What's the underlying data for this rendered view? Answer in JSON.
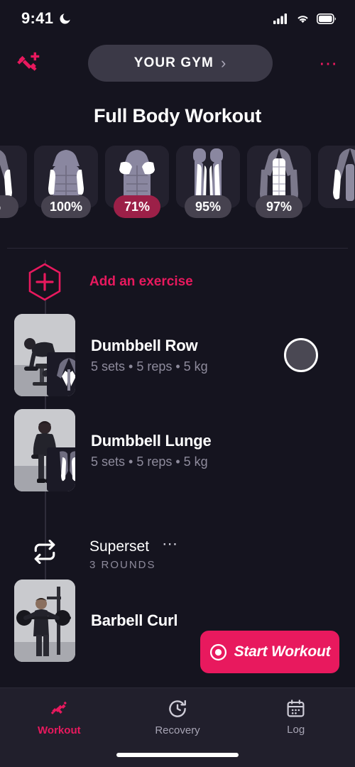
{
  "status_bar": {
    "time": "9:41",
    "moon_icon": "moon-icon",
    "signal_icon": "cellular-signal-icon",
    "wifi_icon": "wifi-icon",
    "battery_icon": "battery-icon"
  },
  "header": {
    "add_workout_icon": "dumbbell-plus-icon",
    "gym_label": "YOUR GYM",
    "chevron": "›",
    "overflow_icon": "more-options-icon"
  },
  "page_title": "Full Body Workout",
  "muscle_groups": [
    {
      "label": "%",
      "highlighted": false,
      "partial": true,
      "art": "arms"
    },
    {
      "label": "100%",
      "highlighted": false,
      "partial": false,
      "art": "biceps"
    },
    {
      "label": "71%",
      "highlighted": true,
      "partial": false,
      "art": "shoulders"
    },
    {
      "label": "95%",
      "highlighted": false,
      "partial": false,
      "art": "quads"
    },
    {
      "label": "97%",
      "highlighted": false,
      "partial": false,
      "art": "back"
    },
    {
      "label": "",
      "highlighted": false,
      "partial": true,
      "art": "arms"
    }
  ],
  "add_exercise": {
    "icon": "hexagon-plus-icon",
    "label": "Add an exercise"
  },
  "exercises": [
    {
      "name": "Dumbbell Row",
      "details": "5 sets • 5 reps • 5 kg",
      "thumbnail": "dumbbell-row-thumbnail",
      "muscle_chip": "back-muscle-chip",
      "has_check": true
    },
    {
      "name": "Dumbbell Lunge",
      "details": "5 sets • 5 reps • 5 kg",
      "thumbnail": "dumbbell-lunge-thumbnail",
      "muscle_chip": "quads-muscle-chip",
      "has_check": false
    }
  ],
  "superset": {
    "icon": "repeat-icon",
    "title": "Superset",
    "overflow_icon": "more-options-icon",
    "rounds": "3 ROUNDS",
    "exercise": {
      "name": "Barbell Curl",
      "thumbnail": "barbell-curl-thumbnail"
    }
  },
  "start_button": {
    "label": "Start Workout",
    "icon": "record-icon"
  },
  "tabs": [
    {
      "label": "Workout",
      "icon": "dumbbell-icon",
      "active": true
    },
    {
      "label": "Recovery",
      "icon": "clock-refresh-icon",
      "active": false
    },
    {
      "label": "Log",
      "icon": "calendar-icon",
      "active": false
    }
  ],
  "colors": {
    "accent": "#e8195e",
    "background": "#15141f",
    "card": "#23212e",
    "badge": "#46424f",
    "badge_highlight": "#9c2048",
    "tabbar": "#211f2c"
  }
}
